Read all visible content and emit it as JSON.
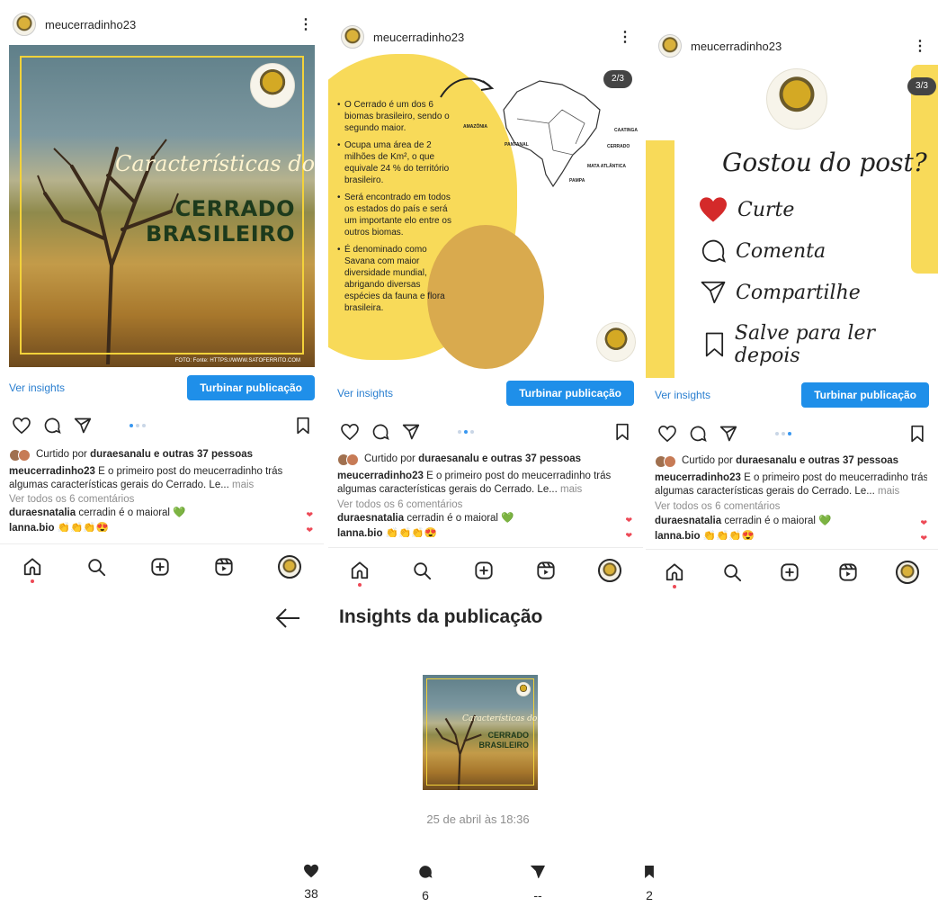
{
  "post": {
    "username": "meucerradinho23",
    "insights_link": "Ver insights",
    "boost_label": "Turbinar publicação",
    "likes_prefix": "Curtido por",
    "likes_user": "duraesanalu",
    "likes_connector": "e",
    "likes_others": "outras 37 pessoas",
    "caption_user": "meucerradinho23",
    "caption_line1": "E o primeiro post do meucerradinho trás",
    "caption_line2": "algumas características gerais do Cerrado. Le...",
    "more": "mais",
    "view_comments": "Ver todos os 6 comentários",
    "comments": [
      {
        "user": "duraesnatalia",
        "text": "cerradin é o maioral 💚"
      },
      {
        "user": "lanna.bio",
        "text": "👏👏👏😍"
      }
    ]
  },
  "slide1": {
    "script_title": "Características do",
    "title_line1": "CERRADO",
    "title_line2": "BRASILEIRO",
    "credit": "FOTO: Fonte: HTTPS://WWW.SATOFERRITO.COM"
  },
  "slide2": {
    "page": "2/3",
    "bullets": [
      "O Cerrado é um dos 6 biomas brasileiro, sendo o segundo maior.",
      "Ocupa uma área de 2 milhões de Km², o que equivale 24 % do território brasileiro.",
      "Será encontrado em todos os estados do país e será um importante elo entre os outros biomas.",
      "É denominado como Savana com maior diversidade mundial, abrigando diversas espécies da fauna e flora brasileira."
    ],
    "map_labels": {
      "amazonia": "AMAZÔNIA",
      "pantanal": "PANTANAL",
      "caatinga": "CAATINGA",
      "cerrado": "CERRADO",
      "mata": "MATA ATLÂNTICA",
      "pampa": "PAMPA"
    }
  },
  "slide3": {
    "page": "3/3",
    "title": "Gostou do post?",
    "items": [
      "Curte",
      "Comenta",
      "Compartilhe",
      "Salve para ler depois"
    ]
  },
  "insights": {
    "title": "Insights da publicação",
    "date": "25 de abril às 18:36",
    "likes": "38",
    "comments": "6",
    "shares": "--",
    "saves": "2"
  },
  "icons": {
    "like": "heart-icon",
    "comment": "comment-icon",
    "share": "paper-plane-icon",
    "save": "bookmark-icon",
    "home": "home-icon",
    "search": "search-icon",
    "new_post": "plus-square-icon",
    "reels": "reels-icon"
  },
  "colors": {
    "accent_blue": "#1f8fe9",
    "link_blue": "#2a7fd0",
    "like_red": "#ed4956",
    "yellow": "#f8da59",
    "heart_cta": "#d42a2a"
  }
}
